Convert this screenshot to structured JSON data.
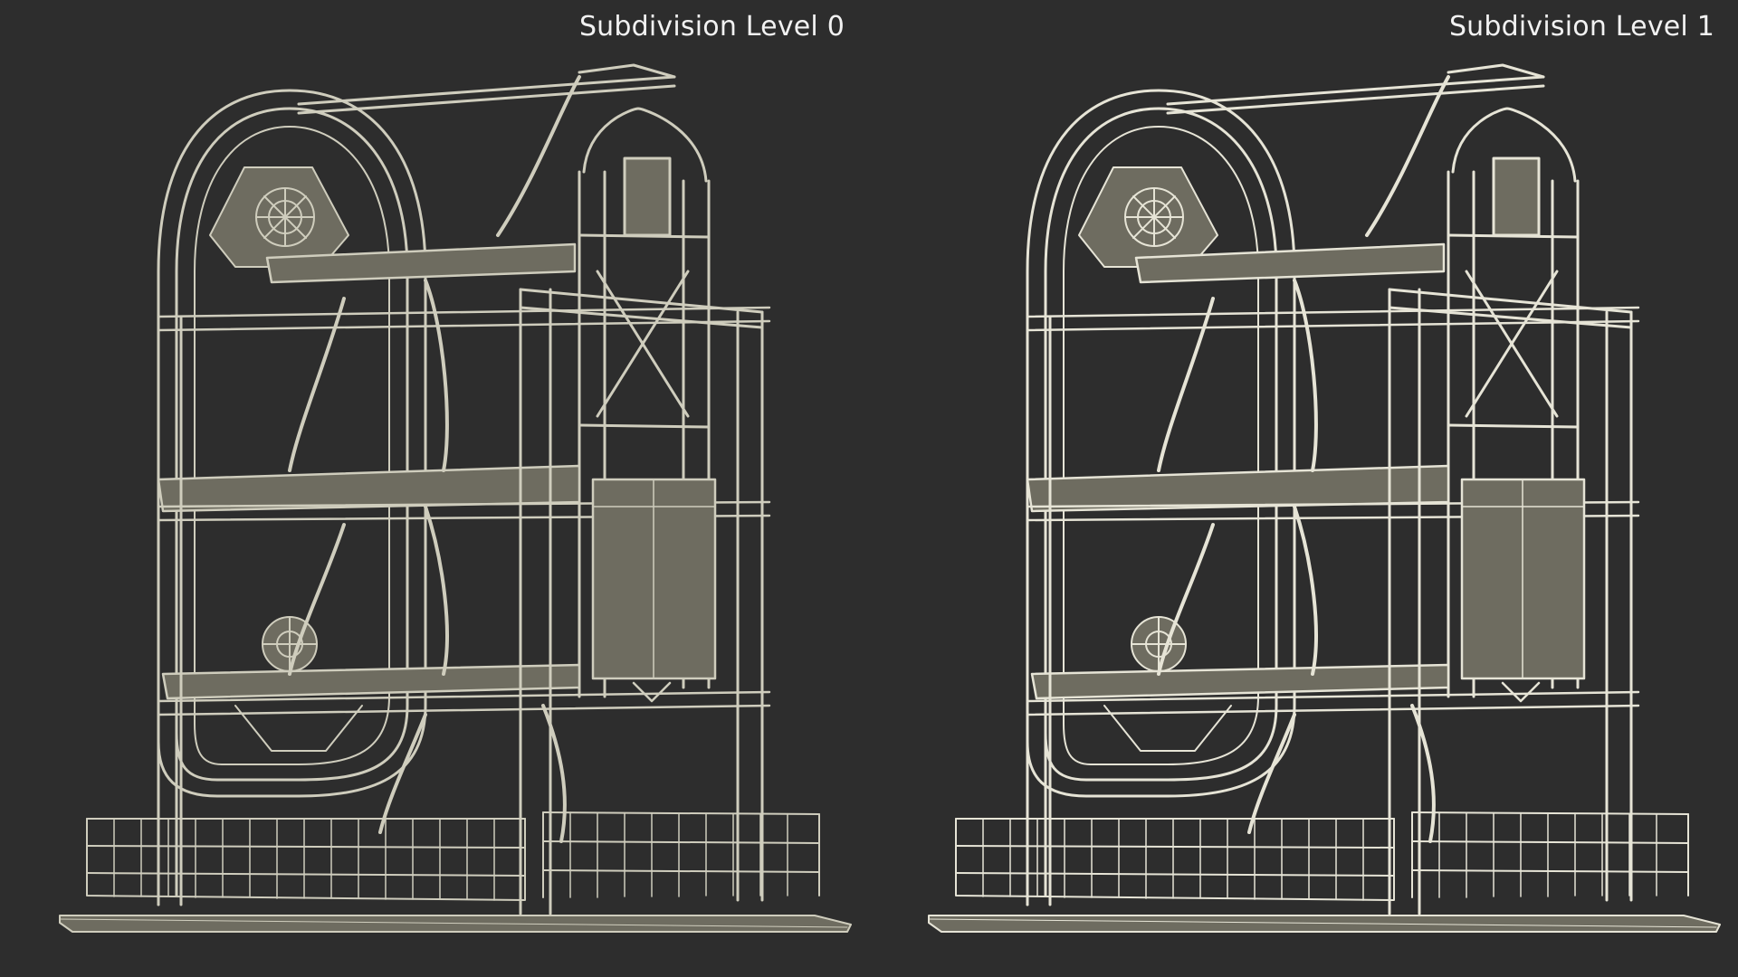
{
  "labels": {
    "left": "Subdivision Level 0",
    "right": "Subdivision Level 1"
  },
  "colors": {
    "background": "#2d2d2d",
    "mesh_fill": "#6e6c60",
    "wire_left": "#cfcdbd",
    "wire_right": "#e6e4d6",
    "label_text": "#f2f2f2"
  }
}
